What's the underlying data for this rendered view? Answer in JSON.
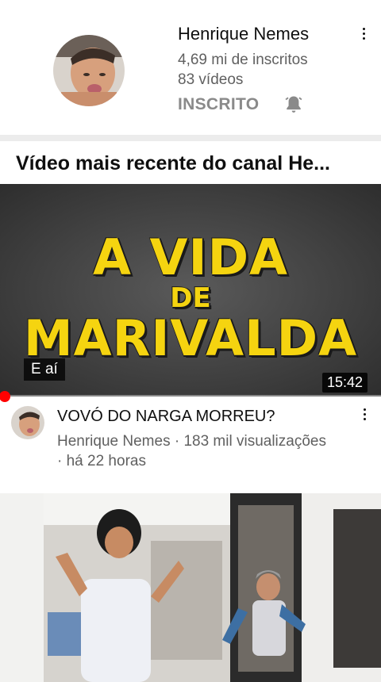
{
  "channel": {
    "name": "Henrique Nemes",
    "subscribers": "4,69 mi de inscritos",
    "videos": "83 vídeos",
    "subscribe_state": "INSCRITO"
  },
  "section": {
    "title": "Vídeo mais recente do canal He..."
  },
  "video1": {
    "thumbnail_text_line1": "A VIDA",
    "thumbnail_text_line2": "DE",
    "thumbnail_text_line3": "MARIVALDA",
    "caption": "E aí",
    "duration": "15:42",
    "title": "VOVÓ DO NARGA MORREU?",
    "meta_line1": "Henrique Nemes · 183 mil visualizações",
    "meta_line2": "· há 22 horas"
  },
  "icons": {
    "bell": "bell-icon",
    "more": "more-vert-icon"
  },
  "colors": {
    "thumbnail_text": "#f5d410",
    "progress": "#ff0000",
    "secondary_text": "#606060"
  }
}
